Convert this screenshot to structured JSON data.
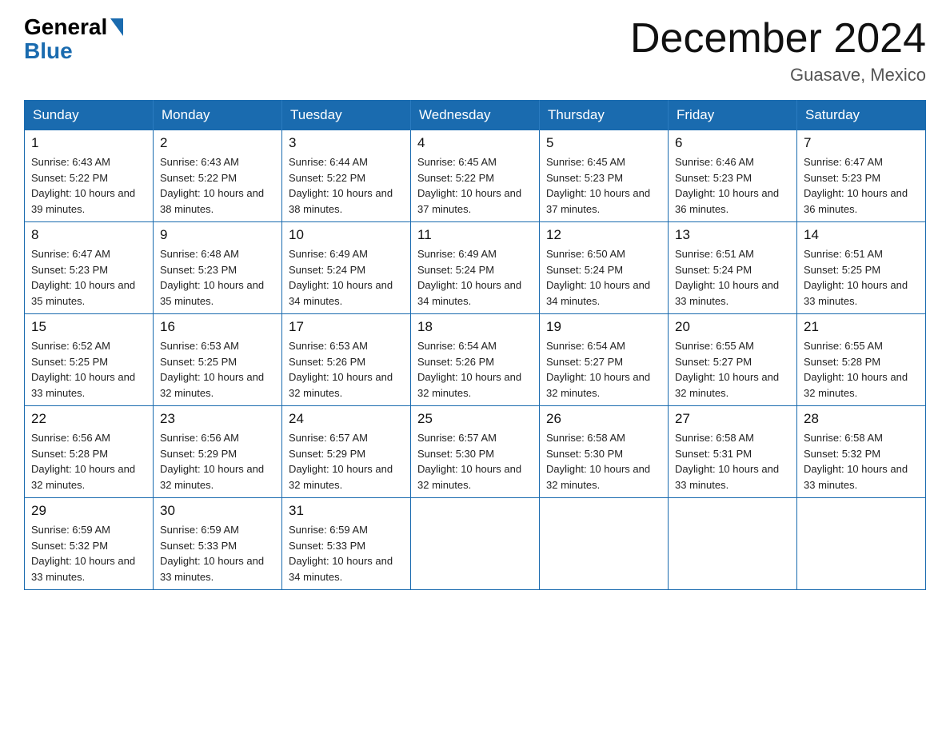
{
  "logo": {
    "part1": "General",
    "part2": "Blue"
  },
  "title": "December 2024",
  "subtitle": "Guasave, Mexico",
  "days_of_week": [
    "Sunday",
    "Monday",
    "Tuesday",
    "Wednesday",
    "Thursday",
    "Friday",
    "Saturday"
  ],
  "weeks": [
    [
      {
        "num": "1",
        "sunrise": "6:43 AM",
        "sunset": "5:22 PM",
        "daylight": "10 hours and 39 minutes."
      },
      {
        "num": "2",
        "sunrise": "6:43 AM",
        "sunset": "5:22 PM",
        "daylight": "10 hours and 38 minutes."
      },
      {
        "num": "3",
        "sunrise": "6:44 AM",
        "sunset": "5:22 PM",
        "daylight": "10 hours and 38 minutes."
      },
      {
        "num": "4",
        "sunrise": "6:45 AM",
        "sunset": "5:22 PM",
        "daylight": "10 hours and 37 minutes."
      },
      {
        "num": "5",
        "sunrise": "6:45 AM",
        "sunset": "5:23 PM",
        "daylight": "10 hours and 37 minutes."
      },
      {
        "num": "6",
        "sunrise": "6:46 AM",
        "sunset": "5:23 PM",
        "daylight": "10 hours and 36 minutes."
      },
      {
        "num": "7",
        "sunrise": "6:47 AM",
        "sunset": "5:23 PM",
        "daylight": "10 hours and 36 minutes."
      }
    ],
    [
      {
        "num": "8",
        "sunrise": "6:47 AM",
        "sunset": "5:23 PM",
        "daylight": "10 hours and 35 minutes."
      },
      {
        "num": "9",
        "sunrise": "6:48 AM",
        "sunset": "5:23 PM",
        "daylight": "10 hours and 35 minutes."
      },
      {
        "num": "10",
        "sunrise": "6:49 AM",
        "sunset": "5:24 PM",
        "daylight": "10 hours and 34 minutes."
      },
      {
        "num": "11",
        "sunrise": "6:49 AM",
        "sunset": "5:24 PM",
        "daylight": "10 hours and 34 minutes."
      },
      {
        "num": "12",
        "sunrise": "6:50 AM",
        "sunset": "5:24 PM",
        "daylight": "10 hours and 34 minutes."
      },
      {
        "num": "13",
        "sunrise": "6:51 AM",
        "sunset": "5:24 PM",
        "daylight": "10 hours and 33 minutes."
      },
      {
        "num": "14",
        "sunrise": "6:51 AM",
        "sunset": "5:25 PM",
        "daylight": "10 hours and 33 minutes."
      }
    ],
    [
      {
        "num": "15",
        "sunrise": "6:52 AM",
        "sunset": "5:25 PM",
        "daylight": "10 hours and 33 minutes."
      },
      {
        "num": "16",
        "sunrise": "6:53 AM",
        "sunset": "5:25 PM",
        "daylight": "10 hours and 32 minutes."
      },
      {
        "num": "17",
        "sunrise": "6:53 AM",
        "sunset": "5:26 PM",
        "daylight": "10 hours and 32 minutes."
      },
      {
        "num": "18",
        "sunrise": "6:54 AM",
        "sunset": "5:26 PM",
        "daylight": "10 hours and 32 minutes."
      },
      {
        "num": "19",
        "sunrise": "6:54 AM",
        "sunset": "5:27 PM",
        "daylight": "10 hours and 32 minutes."
      },
      {
        "num": "20",
        "sunrise": "6:55 AM",
        "sunset": "5:27 PM",
        "daylight": "10 hours and 32 minutes."
      },
      {
        "num": "21",
        "sunrise": "6:55 AM",
        "sunset": "5:28 PM",
        "daylight": "10 hours and 32 minutes."
      }
    ],
    [
      {
        "num": "22",
        "sunrise": "6:56 AM",
        "sunset": "5:28 PM",
        "daylight": "10 hours and 32 minutes."
      },
      {
        "num": "23",
        "sunrise": "6:56 AM",
        "sunset": "5:29 PM",
        "daylight": "10 hours and 32 minutes."
      },
      {
        "num": "24",
        "sunrise": "6:57 AM",
        "sunset": "5:29 PM",
        "daylight": "10 hours and 32 minutes."
      },
      {
        "num": "25",
        "sunrise": "6:57 AM",
        "sunset": "5:30 PM",
        "daylight": "10 hours and 32 minutes."
      },
      {
        "num": "26",
        "sunrise": "6:58 AM",
        "sunset": "5:30 PM",
        "daylight": "10 hours and 32 minutes."
      },
      {
        "num": "27",
        "sunrise": "6:58 AM",
        "sunset": "5:31 PM",
        "daylight": "10 hours and 33 minutes."
      },
      {
        "num": "28",
        "sunrise": "6:58 AM",
        "sunset": "5:32 PM",
        "daylight": "10 hours and 33 minutes."
      }
    ],
    [
      {
        "num": "29",
        "sunrise": "6:59 AM",
        "sunset": "5:32 PM",
        "daylight": "10 hours and 33 minutes."
      },
      {
        "num": "30",
        "sunrise": "6:59 AM",
        "sunset": "5:33 PM",
        "daylight": "10 hours and 33 minutes."
      },
      {
        "num": "31",
        "sunrise": "6:59 AM",
        "sunset": "5:33 PM",
        "daylight": "10 hours and 34 minutes."
      },
      null,
      null,
      null,
      null
    ]
  ]
}
